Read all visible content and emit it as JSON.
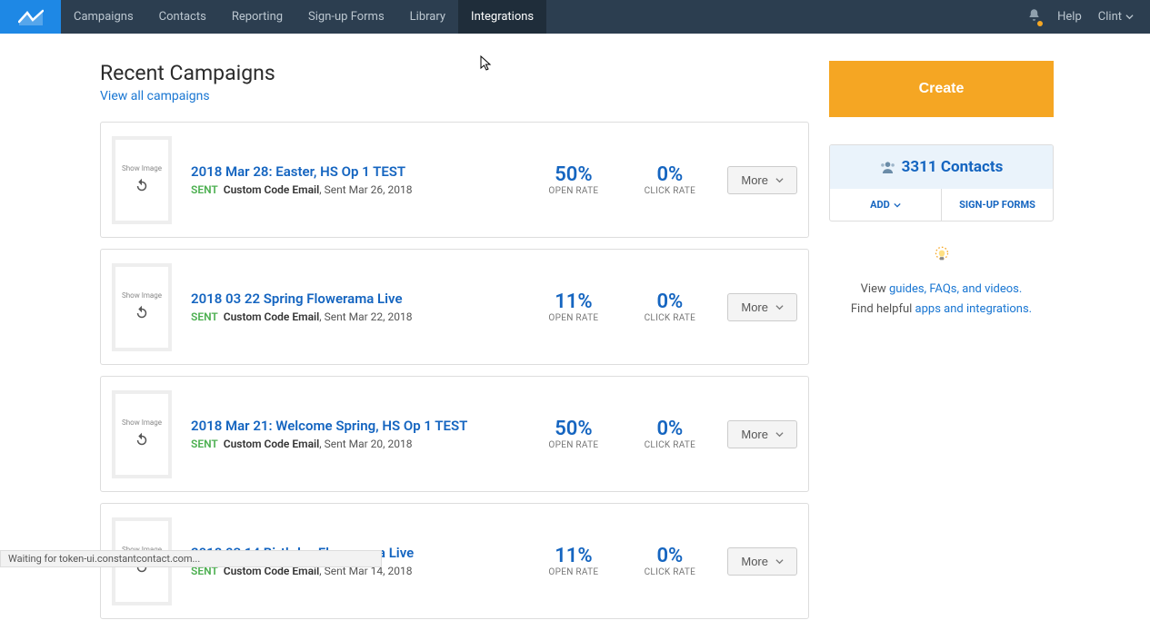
{
  "nav": {
    "items": [
      "Campaigns",
      "Contacts",
      "Reporting",
      "Sign-up Forms",
      "Library",
      "Integrations"
    ],
    "activeIndex": 5
  },
  "header": {
    "help": "Help",
    "user": "Clint"
  },
  "page": {
    "title": "Recent Campaigns",
    "view_all": "View all campaigns"
  },
  "thumb": {
    "label": "Show\nImage"
  },
  "campaigns": [
    {
      "title": "2018 Mar 28: Easter, HS Op 1 TEST",
      "status": "SENT",
      "type": "Custom Code Email",
      "sent": ", Sent Mar 26, 2018",
      "open_rate": "50%",
      "click_rate": "0%"
    },
    {
      "title": "2018 03 22 Spring Flowerama Live",
      "status": "SENT",
      "type": "Custom Code Email",
      "sent": ", Sent Mar 22, 2018",
      "open_rate": "11%",
      "click_rate": "0%"
    },
    {
      "title": "2018 Mar 21: Welcome Spring, HS Op 1 TEST",
      "status": "SENT",
      "type": "Custom Code Email",
      "sent": ", Sent Mar 20, 2018",
      "open_rate": "50%",
      "click_rate": "0%"
    },
    {
      "title": "2018 03 14 Birthday Flowerama Live",
      "status": "SENT",
      "type": "Custom Code Email",
      "sent": ", Sent Mar 14, 2018",
      "open_rate": "11%",
      "click_rate": "0%"
    }
  ],
  "labels": {
    "open_rate": "OPEN RATE",
    "click_rate": "CLICK RATE",
    "more": "More"
  },
  "sidebar": {
    "create": "Create",
    "contacts_count": "3311 Contacts",
    "add": "ADD",
    "signup": "SIGN-UP FORMS",
    "tips1a": "View ",
    "tips1b": "guides, FAQs, and videos.",
    "tips2a": "Find helpful ",
    "tips2b": "apps and integrations."
  },
  "status_bar": "Waiting for token-ui.constantcontact.com..."
}
